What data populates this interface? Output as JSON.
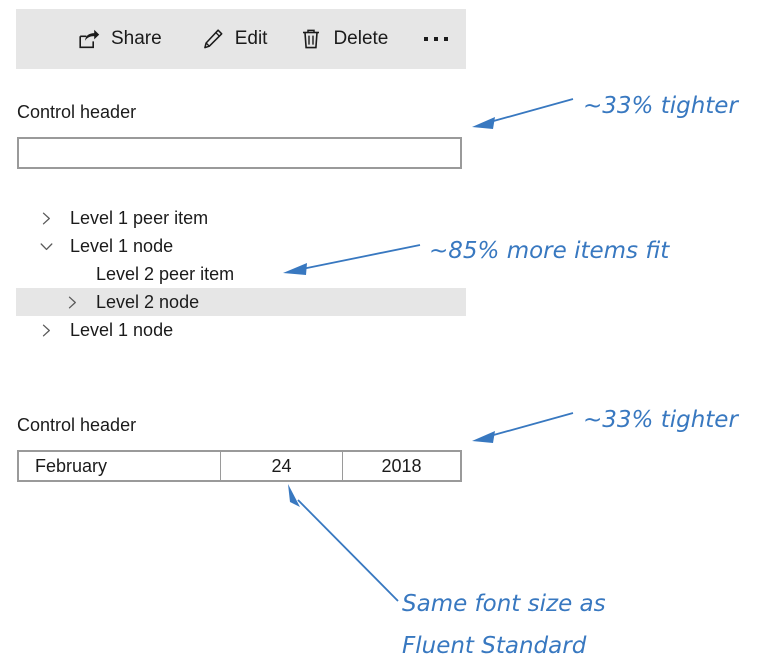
{
  "command_bar": {
    "items": [
      {
        "label": "Share",
        "icon": "share-icon"
      },
      {
        "label": "Edit",
        "icon": "pencil-icon"
      },
      {
        "label": "Delete",
        "icon": "trash-icon"
      }
    ],
    "overflow_label": "",
    "overflow_icon": "more-ellipsis-icon",
    "background": "#e6e6e6"
  },
  "text_field_section": {
    "header": "Control header",
    "value": "",
    "placeholder": ""
  },
  "tree": {
    "items": [
      {
        "label": "Level 1 peer item",
        "level": 1,
        "chevron": "chevron-right-icon",
        "expanded": false,
        "selected": false
      },
      {
        "label": "Level 1 node",
        "level": 1,
        "chevron": "chevron-down-icon",
        "expanded": true,
        "selected": false
      },
      {
        "label": "Level 2 peer item",
        "level": 2,
        "chevron": "none",
        "expanded": false,
        "selected": false
      },
      {
        "label": "Level 2 node",
        "level": 2,
        "chevron": "chevron-right-icon",
        "expanded": false,
        "selected": true
      },
      {
        "label": "Level 1 node",
        "level": 1,
        "chevron": "chevron-right-icon",
        "expanded": false,
        "selected": false
      }
    ],
    "selected_background": "#e6e6e6"
  },
  "date_picker_section": {
    "header": "Control header",
    "month": "February",
    "day": "24",
    "year": "2018"
  },
  "annotations": {
    "accent_color": "#3878c0",
    "a1": "~33% tighter",
    "a2": "~85% more items fit",
    "a3": "~33% tighter",
    "a4_line1": "Same font size as",
    "a4_line2": "Fluent Standard"
  }
}
